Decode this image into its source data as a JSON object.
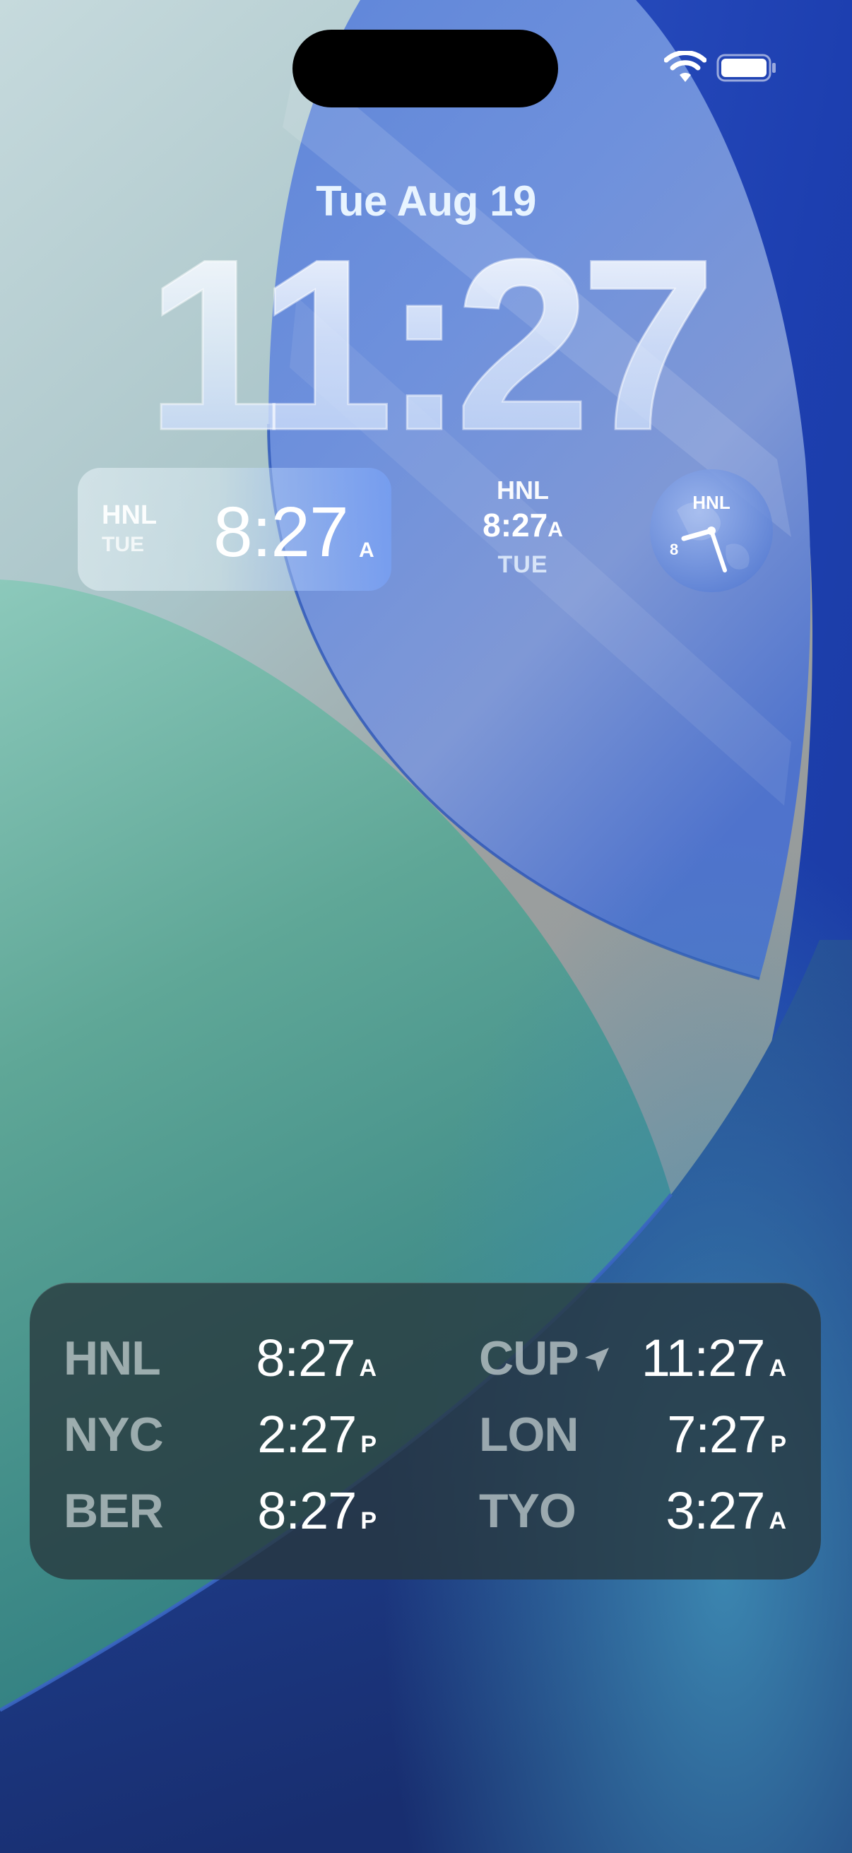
{
  "lock_screen": {
    "date": "Tue Aug 19",
    "time": "11:27"
  },
  "status_bar": {
    "icons": [
      "wifi-icon",
      "battery-icon"
    ]
  },
  "widgets": {
    "world_rect": {
      "city": "HNL",
      "day": "TUE",
      "time": "8:27",
      "ampm": "A"
    },
    "world_inline": {
      "city": "HNL",
      "time": "8:27",
      "ampm": "A",
      "day": "TUE"
    },
    "analog_clock": {
      "city": "HNL",
      "hour_label": "8",
      "time_shown": "8:27"
    }
  },
  "world_clock": {
    "left": [
      {
        "city": "HNL",
        "time": "8:27",
        "ampm": "A"
      },
      {
        "city": "NYC",
        "time": "2:27",
        "ampm": "P"
      },
      {
        "city": "BER",
        "time": "8:27",
        "ampm": "P"
      }
    ],
    "right": [
      {
        "city": "CUP",
        "time": "11:27",
        "ampm": "A",
        "icon": "location-arrow-icon"
      },
      {
        "city": "LON",
        "time": "7:27",
        "ampm": "P"
      },
      {
        "city": "TYO",
        "time": "3:27",
        "ampm": "A"
      }
    ]
  },
  "colors": {
    "wallpaper_blue": "#3f6fd8",
    "wallpaper_teal": "#4f9c8c",
    "wallpaper_gray": "#9da3a3",
    "panel": "#2b3a3e"
  }
}
